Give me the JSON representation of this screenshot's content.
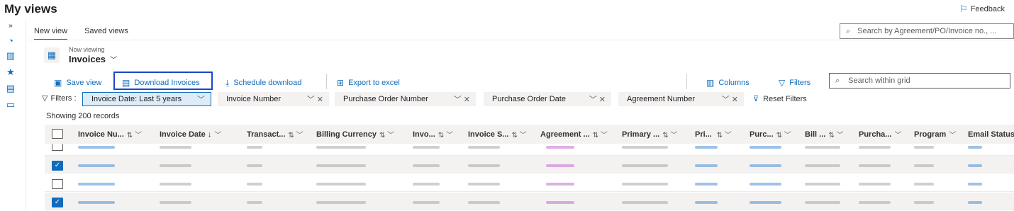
{
  "page": {
    "title": "My views",
    "feedback_label": "Feedback"
  },
  "rail": {
    "icons": [
      "expand-icon",
      "dashboard-icon",
      "views-icon",
      "favorites-icon",
      "document-icon",
      "presentation-icon"
    ]
  },
  "tabs": [
    {
      "label": "New view",
      "active": true
    },
    {
      "label": "Saved views",
      "active": false
    }
  ],
  "top_search": {
    "placeholder": "Search by Agreement/PO/Invoice no., ..."
  },
  "now_viewing": {
    "caption": "Now viewing",
    "value": "Invoices"
  },
  "toolbar": {
    "save_view": "Save view",
    "download_invoices": "Download Invoices",
    "schedule_download": "Schedule download",
    "export_excel": "Export to excel",
    "columns": "Columns",
    "filters": "Filters",
    "grid_search_placeholder": "Search within grid"
  },
  "filters": {
    "label": "Filters :",
    "chips": [
      {
        "label": "Invoice Date:  Last 5 years",
        "selected": true
      },
      {
        "label": "Invoice Number",
        "selected": false
      },
      {
        "label": "Purchase Order Number",
        "selected": false
      },
      {
        "label": "Purchase Order Date",
        "selected": false
      },
      {
        "label": "Agreement Number",
        "selected": false
      }
    ],
    "reset_label": "Reset Filters"
  },
  "grid": {
    "record_count_text": "Showing 200 records",
    "columns": [
      "Invoice Nu...",
      "Invoice Date ↓",
      "Transact...",
      "Billing Currency",
      "Invo...",
      "Invoice S...",
      "Agreement ...",
      "Primary ...",
      "Pri...",
      "Purc...",
      "Bill ...",
      "Purcha...",
      "Program",
      "Email Status"
    ],
    "rows": [
      {
        "checked": false
      },
      {
        "checked": true
      },
      {
        "checked": false
      },
      {
        "checked": true
      }
    ]
  },
  "colors": {
    "accent": "#0f6cbd",
    "highlight_border": "#1a47c7",
    "selected_chip_bg": "#deecf9"
  }
}
